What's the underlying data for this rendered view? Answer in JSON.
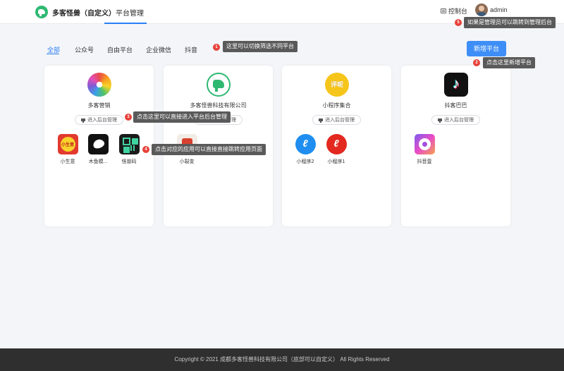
{
  "header": {
    "brand": "多客怪兽（自定义）",
    "nav": "平台管理",
    "console": "控制台",
    "user": "admin"
  },
  "tabs": [
    "全部",
    "公众号",
    "自由平台",
    "企业微信",
    "抖音"
  ],
  "add_button": "新增平台",
  "enter_backend": "进入后台管理",
  "cards": [
    {
      "title": "多客营销",
      "logo": "flower-logo",
      "apps": [
        {
          "name": "小生意",
          "icon": "xiaoshengyi-icon"
        },
        {
          "name": "木鱼模...",
          "icon": "fish-icon"
        },
        {
          "name": "怪兽码",
          "icon": "qrcode-icon"
        }
      ]
    },
    {
      "title": "多客怪兽科技有限公司",
      "logo": "dino-logo",
      "apps": [
        {
          "name": "小裂变",
          "icon": "xiaoliebian-icon"
        }
      ]
    },
    {
      "title": "小程序集合",
      "logo": "yellow-logo",
      "logo_text": "评呢",
      "apps": [
        {
          "name": "小程序2",
          "icon": "miniprogram-icon"
        },
        {
          "name": "小程序1",
          "icon": "miniprogram-icon"
        }
      ]
    },
    {
      "title": "抖客巴巴",
      "logo": "tiktok-logo",
      "apps": [
        {
          "name": "抖音壹",
          "icon": "disc-icon"
        }
      ]
    }
  ],
  "app_glyphs": {
    "xiaoshengyi": "小生意",
    "miniprogram": "ℓ"
  },
  "tips": [
    {
      "num": "1",
      "text": "这里可以切换筛选不同平台"
    },
    {
      "num": "2",
      "text": "点击这里新增平台"
    },
    {
      "num": "3",
      "text": "点击这里可以直接进入平台后台管理"
    },
    {
      "num": "4",
      "text": "点击对应的应用可以直接直接跳转应用页面"
    },
    {
      "num": "5",
      "text": "如果是管理员可以跳转到管理后台"
    }
  ],
  "footer": "Copyright © 2021 成都多客怪兽科技有限公司（底部可以自定义） All Rights Reserved",
  "colors": {
    "accent": "#2a7ff5",
    "button": "#3e8ef7",
    "brand_green": "#2eb872",
    "badge_red": "#e8413a",
    "footer_bg": "#2f2f2f"
  }
}
